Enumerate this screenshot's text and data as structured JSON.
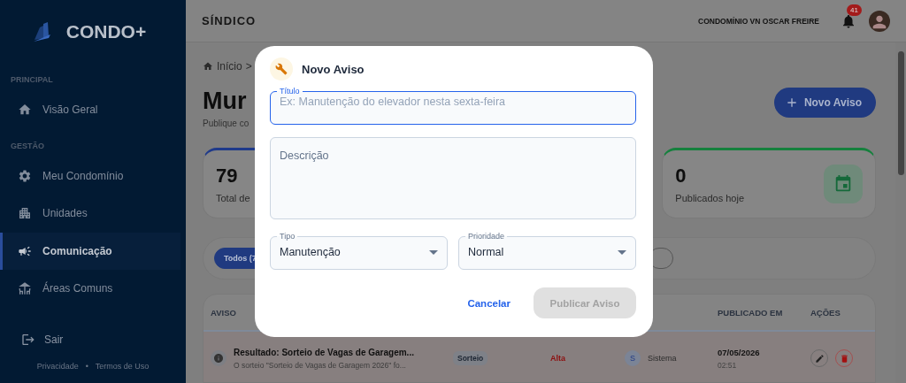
{
  "sidebar": {
    "logo": "CONDO+",
    "sections": [
      {
        "label": "PRINCIPAL",
        "items": [
          {
            "label": "Visão Geral",
            "selected": false
          }
        ]
      },
      {
        "label": "GESTÃO",
        "items": [
          {
            "label": "Meu Condomínio",
            "selected": false
          },
          {
            "label": "Unidades",
            "selected": false
          },
          {
            "label": "Comunicação",
            "selected": true
          },
          {
            "label": "Áreas Comuns",
            "selected": false
          }
        ]
      }
    ],
    "logout": "Sair",
    "footer": [
      "Privacidade",
      "•",
      "Termos de Uso"
    ]
  },
  "header": {
    "role": "SÍNDICO",
    "condo": "CONDOMÍNIO VN OSCAR FREIRE",
    "notifications": "41"
  },
  "breadcrumb": [
    "Início",
    ">"
  ],
  "page": {
    "title": "Mur",
    "subtitle": "Publique co",
    "new_button": "Novo Aviso"
  },
  "stats": [
    {
      "value": "79",
      "label": "Total de",
      "color": "#1f3a8a"
    },
    {
      "value": "0",
      "label": "Publicados hoje",
      "color": "#15803d"
    }
  ],
  "filters": [
    {
      "label": "Todos (7",
      "selected": true
    },
    {
      "selected": false
    }
  ],
  "table": {
    "columns": [
      "AVISO",
      "PUBLICADO EM",
      "AÇÕES"
    ],
    "rows": [
      {
        "title": "Resultado: Sorteio de Vagas de Garagem...",
        "excerpt": "O sorteio \"Sorteio de Vagas de Garagem 2026\" fo...",
        "type": "Sorteio",
        "priority": "Alta",
        "author_initial": "S",
        "author": "Sistema",
        "date": "07/05/2026",
        "time": "02:51"
      }
    ]
  },
  "dialog": {
    "title": "Novo Aviso",
    "fields": [
      {
        "kind": "text",
        "label": "Título",
        "placeholder": "Ex: Manutenção do elevador nesta sexta-feira",
        "focused": true
      },
      {
        "kind": "textarea",
        "placeholder": "Descrição",
        "focused": false
      }
    ],
    "selects": [
      {
        "label": "Tipo",
        "value": "Manutenção"
      },
      {
        "label": "Prioridade",
        "value": "Normal"
      }
    ],
    "cancel": "Cancelar",
    "submit": {
      "label": "Publicar Aviso",
      "disabled": true
    }
  }
}
